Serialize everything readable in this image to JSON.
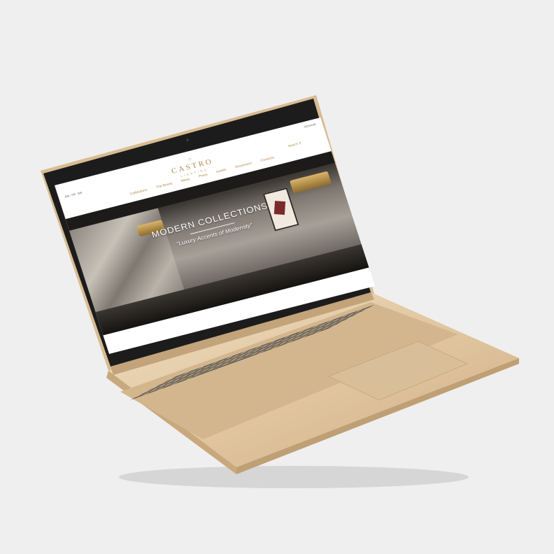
{
  "site": {
    "brand": "CASTRO",
    "brand_sub": "LIGHTING",
    "account_label": "Account",
    "language_label": "EN  ·  FR  ·  ES",
    "search_label": "Search",
    "nav": [
      "Collections",
      "The Brand",
      "News",
      "Press",
      "Hotels",
      "Showroom",
      "Contacts"
    ]
  },
  "hero": {
    "title": "MODERN COLLECTIONS",
    "tagline": "\"Luxury Accents of Modernity\""
  },
  "colors": {
    "background": "#efefef",
    "laptop_gold": "#e2c9a4",
    "keys": "#4b4b4b",
    "bezel": "#1c1c1c",
    "accent": "#b48a4e"
  }
}
